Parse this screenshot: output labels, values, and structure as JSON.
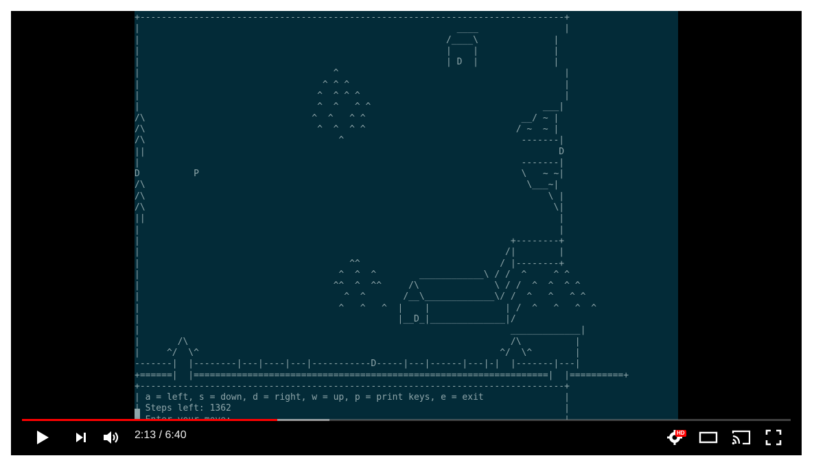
{
  "terminal": {
    "screen_lines": [
      "+-------------------------------------------------------------------------------+",
      "|                                                           ____                |",
      "|                                                         /____\\              |",
      "|                                                         |    |              |",
      "|                                                         | D  |              |",
      "|                                    ^                                          |",
      "|                                  ^ ^ ^                                        |",
      "|                                 ^  ^ ^ ^                                      |",
      "|                                 ^  ^   ^ ^                                ___|",
      "/\\                               ^  ^   ^ ^                             __/ ~ |",
      "/\\                                ^  ^  ^ ^                            / ~  ~ |",
      "/\\                                    ^                                 -------|",
      "||                                                                             D",
      "|                                                                       -------|",
      "D          P                                                            \\   ~ ~|",
      "/\\                                                                       \\___~|",
      "/\\                                                                           \\ |",
      "/\\                                                                            \\|",
      "||                                                                             |",
      "|                                                                              |",
      "|                                                                     +--------+",
      "|                                                                    /|        |",
      "|                                       ^^                          / |--------+",
      "|                                     ^  ^  ^        ____________\\ / /  ^     ^ ^",
      "|                                    ^^  ^  ^^     /\\              \\ / /  ^  ^  ^ ^",
      "|                                      ^  ^       /__\\_____________\\/ /  ^   ^   ^ ^",
      "|                                     ^   ^   ^  |    |              | /  ^   ^   ^  ^",
      "|                                                |__D_|______________|/",
      "|                                                                     _____________|",
      "|       /\\                                                            /\\          |",
      "|     ^/  \\^                                                        ^/  \\^        |",
      "-------|  |--------|---|----|---|-----------D-----|---|------|---|-|  |-------|---|",
      "+======|  |==================================================================|  |==========+",
      "+-------------------------------------------------------------------------------+",
      "| a = left, s = down, d = right, w = up, p = print keys, e = exit               |",
      "| Steps left: 1362                                                              |",
      "| Enter your move:                                                              |",
      "+-------------------------------------------------------------------------------+"
    ]
  },
  "player": {
    "time_display": "2:13 / 6:40",
    "played_fraction": 0.3325,
    "buffered_fraction": 0.4,
    "hd_badge": "HD",
    "icons": {
      "play": "play-icon",
      "next": "next-icon",
      "volume": "volume-icon",
      "settings": "settings-icon",
      "theater": "theater-mode-icon",
      "cast": "cast-icon",
      "fullscreen": "fullscreen-icon"
    },
    "colors": {
      "progress_played": "#ff0000",
      "terminal_bg": "#032b38",
      "terminal_fg": "#8fa6aa"
    }
  }
}
